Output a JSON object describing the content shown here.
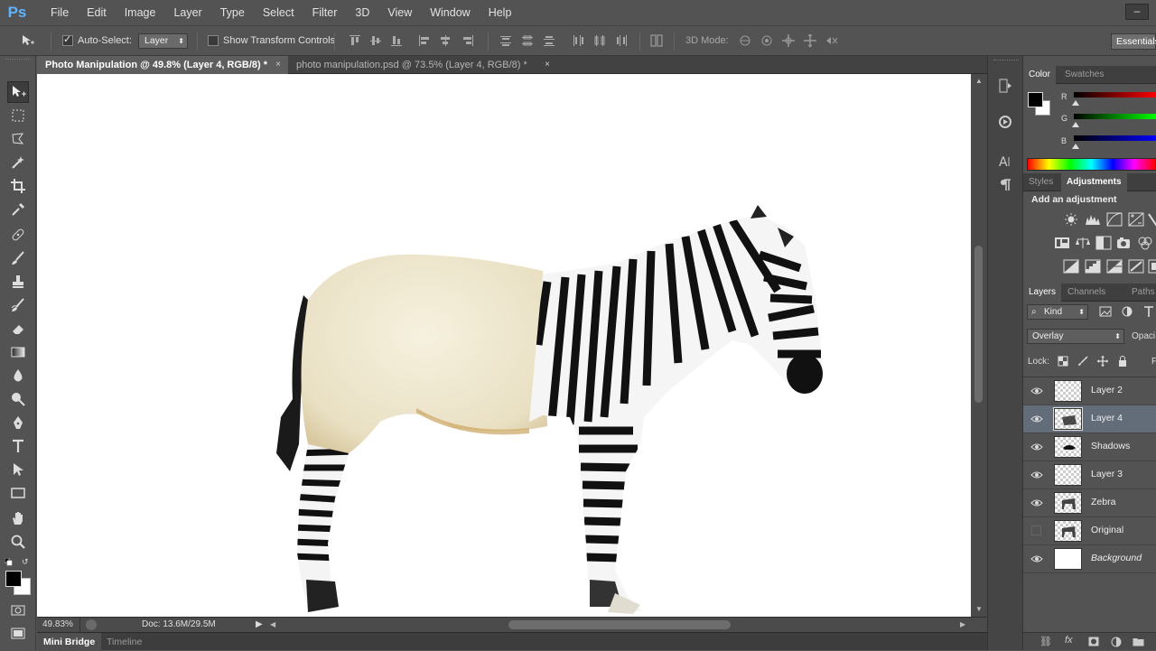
{
  "app": {
    "logo": "Ps"
  },
  "menu": [
    "File",
    "Edit",
    "Image",
    "Layer",
    "Type",
    "Select",
    "Filter",
    "3D",
    "View",
    "Window",
    "Help"
  ],
  "window_min": "–",
  "options": {
    "auto_select_label": "Auto-Select:",
    "auto_select_checked": true,
    "auto_select_target": "Layer",
    "show_transform_label": "Show Transform Controls",
    "mode_3d_label": "3D Mode:",
    "workspace": "Essentials"
  },
  "tabs": [
    {
      "label": "Photo Manipulation @ 49.8% (Layer 4, RGB/8) *",
      "active": true
    },
    {
      "label": "photo manipulation.psd @ 73.5% (Layer 4, RGB/8) *",
      "active": false
    }
  ],
  "tab_close": "×",
  "status": {
    "zoom": "49.83%",
    "doc": "Doc: 13.6M/29.5M"
  },
  "bottom_tabs": [
    "Mini Bridge",
    "Timeline"
  ],
  "color_panel": {
    "tabs": [
      "Color",
      "Swatches"
    ],
    "sliders": [
      {
        "label": "R",
        "color": "#ff0000",
        "value": 0
      },
      {
        "label": "G",
        "color": "#00ff00",
        "value": 0
      },
      {
        "label": "B",
        "color": "#0000ff",
        "value": 0
      }
    ],
    "foreground": "#000000",
    "background": "#ffffff"
  },
  "adjust_panel": {
    "tabs": [
      "Styles",
      "Adjustments"
    ],
    "title": "Add an adjustment"
  },
  "layers_panel": {
    "tabs": [
      "Layers",
      "Channels",
      "Paths"
    ],
    "filter": "Kind",
    "blend_mode": "Overlay",
    "opacity_label": "Opaci",
    "lock_label": "Lock:",
    "fill_label": "F",
    "layers": [
      {
        "name": "Layer 2",
        "visible": true,
        "selected": false,
        "thumb": "transparent"
      },
      {
        "name": "Layer 4",
        "visible": true,
        "selected": true,
        "thumb": "transparent-art"
      },
      {
        "name": "Shadows",
        "visible": true,
        "selected": false,
        "thumb": "transparent-art"
      },
      {
        "name": "Layer 3",
        "visible": true,
        "selected": false,
        "thumb": "transparent"
      },
      {
        "name": "Zebra",
        "visible": true,
        "selected": false,
        "thumb": "transparent-art"
      },
      {
        "name": "Original",
        "visible": false,
        "selected": false,
        "thumb": "transparent-art"
      },
      {
        "name": "Background",
        "visible": true,
        "selected": false,
        "thumb": "white",
        "italic": true
      }
    ]
  },
  "tools": [
    "move-tool",
    "marquee-tool",
    "lasso-tool",
    "magic-wand-tool",
    "crop-tool",
    "eyedropper-tool",
    "healing-brush-tool",
    "brush-tool",
    "clone-stamp-tool",
    "history-brush-tool",
    "eraser-tool",
    "gradient-tool",
    "blur-tool",
    "dodge-tool",
    "pen-tool",
    "type-tool",
    "path-selection-tool",
    "rectangle-tool",
    "hand-tool",
    "zoom-tool"
  ]
}
